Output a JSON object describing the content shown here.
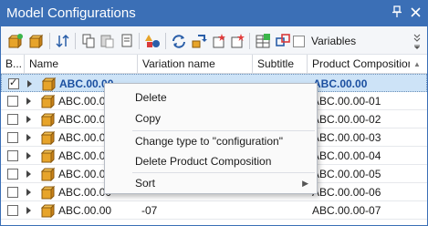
{
  "window": {
    "title": "Model Configurations"
  },
  "titlebar": {
    "pin_glyph": "📌",
    "close_glyph": "✕"
  },
  "toolbar": {
    "variables_label": "Variables",
    "variables_checked": false,
    "overflow_glyph": "»",
    "icons": [
      "new-configuration-icon",
      "package-icon",
      "sort-icon",
      "copy-icon",
      "paste-icon",
      "duplicate-icon",
      "shapes-icon",
      "refresh-icon",
      "sync-icon",
      "new-item-icon",
      "new-star-icon",
      "add-table-icon",
      "link-icon"
    ]
  },
  "columns": {
    "checkbox": "B...",
    "name": "Name",
    "variation": "Variation name",
    "subtitle": "Subtitle",
    "composition": "Product Composition"
  },
  "rows": [
    {
      "checked": true,
      "name": "ABC.00.00",
      "variation": "",
      "subtitle": "",
      "composition": "ABC.00.00",
      "selected": true
    },
    {
      "checked": false,
      "name": "ABC.00.00",
      "variation": "",
      "subtitle": "",
      "composition": "ABC.00.00-01",
      "selected": false
    },
    {
      "checked": false,
      "name": "ABC.00.00",
      "variation": "",
      "subtitle": "",
      "composition": "ABC.00.00-02",
      "selected": false
    },
    {
      "checked": false,
      "name": "ABC.00.00",
      "variation": "",
      "subtitle": "",
      "composition": "ABC.00.00-03",
      "selected": false
    },
    {
      "checked": false,
      "name": "ABC.00.00",
      "variation": "",
      "subtitle": "",
      "composition": "ABC.00.00-04",
      "selected": false
    },
    {
      "checked": false,
      "name": "ABC.00.00",
      "variation": "",
      "subtitle": "",
      "composition": "ABC.00.00-05",
      "selected": false
    },
    {
      "checked": false,
      "name": "ABC.00.00",
      "variation": "",
      "subtitle": "",
      "composition": "ABC.00.00-06",
      "selected": false
    },
    {
      "checked": false,
      "name": "ABC.00.00",
      "variation": "-07",
      "subtitle": "",
      "composition": "ABC.00.00-07",
      "selected": false
    }
  ],
  "context_menu": {
    "items": [
      "Delete",
      "Copy",
      "Change type to \"configuration\"",
      "Delete Product Composition",
      "Sort"
    ],
    "submenu_arrow": "▶"
  },
  "colors": {
    "accent": "#3b6fb6",
    "selection": "#cde3f7",
    "selected_text": "#1b4fa0"
  }
}
